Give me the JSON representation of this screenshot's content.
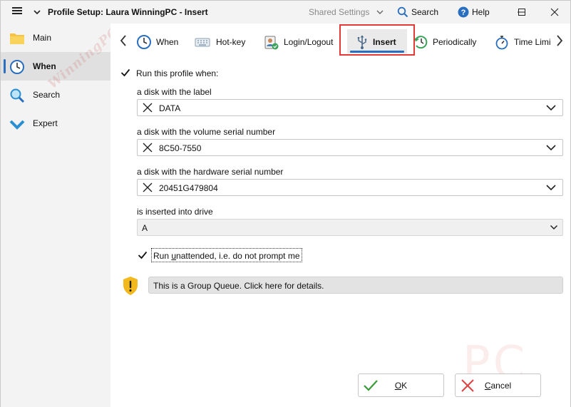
{
  "titlebar": {
    "title": "Profile Setup: Laura WinningPC - Insert",
    "shared_settings": "Shared Settings",
    "search": "Search",
    "help": "Help"
  },
  "sidebar": {
    "items": [
      {
        "label": "Main",
        "icon": "folder-icon"
      },
      {
        "label": "When",
        "icon": "clock-icon",
        "active": true
      },
      {
        "label": "Search",
        "icon": "magnifier-icon"
      },
      {
        "label": "Expert",
        "icon": "chevron-check-icon"
      }
    ]
  },
  "tabs": [
    {
      "label": "When",
      "icon": "clock-icon"
    },
    {
      "label": "Hot-key",
      "icon": "keyboard-icon"
    },
    {
      "label": "Login/Logout",
      "icon": "user-badge-icon"
    },
    {
      "label": "Insert",
      "icon": "usb-icon",
      "active": true
    },
    {
      "label": "Periodically",
      "icon": "refresh-clock-icon"
    },
    {
      "label": "Time Limi",
      "icon": "stopwatch-icon"
    }
  ],
  "content": {
    "run_profile_label": "Run this profile when:",
    "run_profile_checked": true,
    "disk_label_caption": "a disk with the label",
    "disk_label_value": "DATA",
    "volume_serial_caption": "a disk with the volume serial number",
    "volume_serial_value": "8C50-7550",
    "hardware_serial_caption": "a disk with the hardware serial number",
    "hardware_serial_value": "20451G479804",
    "drive_caption": "is inserted into drive",
    "drive_value": "A",
    "unattended_prefix": "Run ",
    "unattended_underlined": "u",
    "unattended_rest": "nattended, i.e. do not prompt me",
    "unattended_checked": true,
    "group_queue_text": "This is a Group Queue. Click here for details."
  },
  "buttons": {
    "ok_underlined": "O",
    "ok_rest": "K",
    "cancel_underlined": "C",
    "cancel_rest": "ancel"
  },
  "watermark": {
    "side_text": "WinningPC",
    "corner_text": "PC"
  },
  "colors": {
    "accent": "#2a6fbf",
    "highlight": "#e53935",
    "ok_check": "#3a9a3a",
    "cancel_x": "#e04040",
    "shield": "#f2b81c"
  }
}
